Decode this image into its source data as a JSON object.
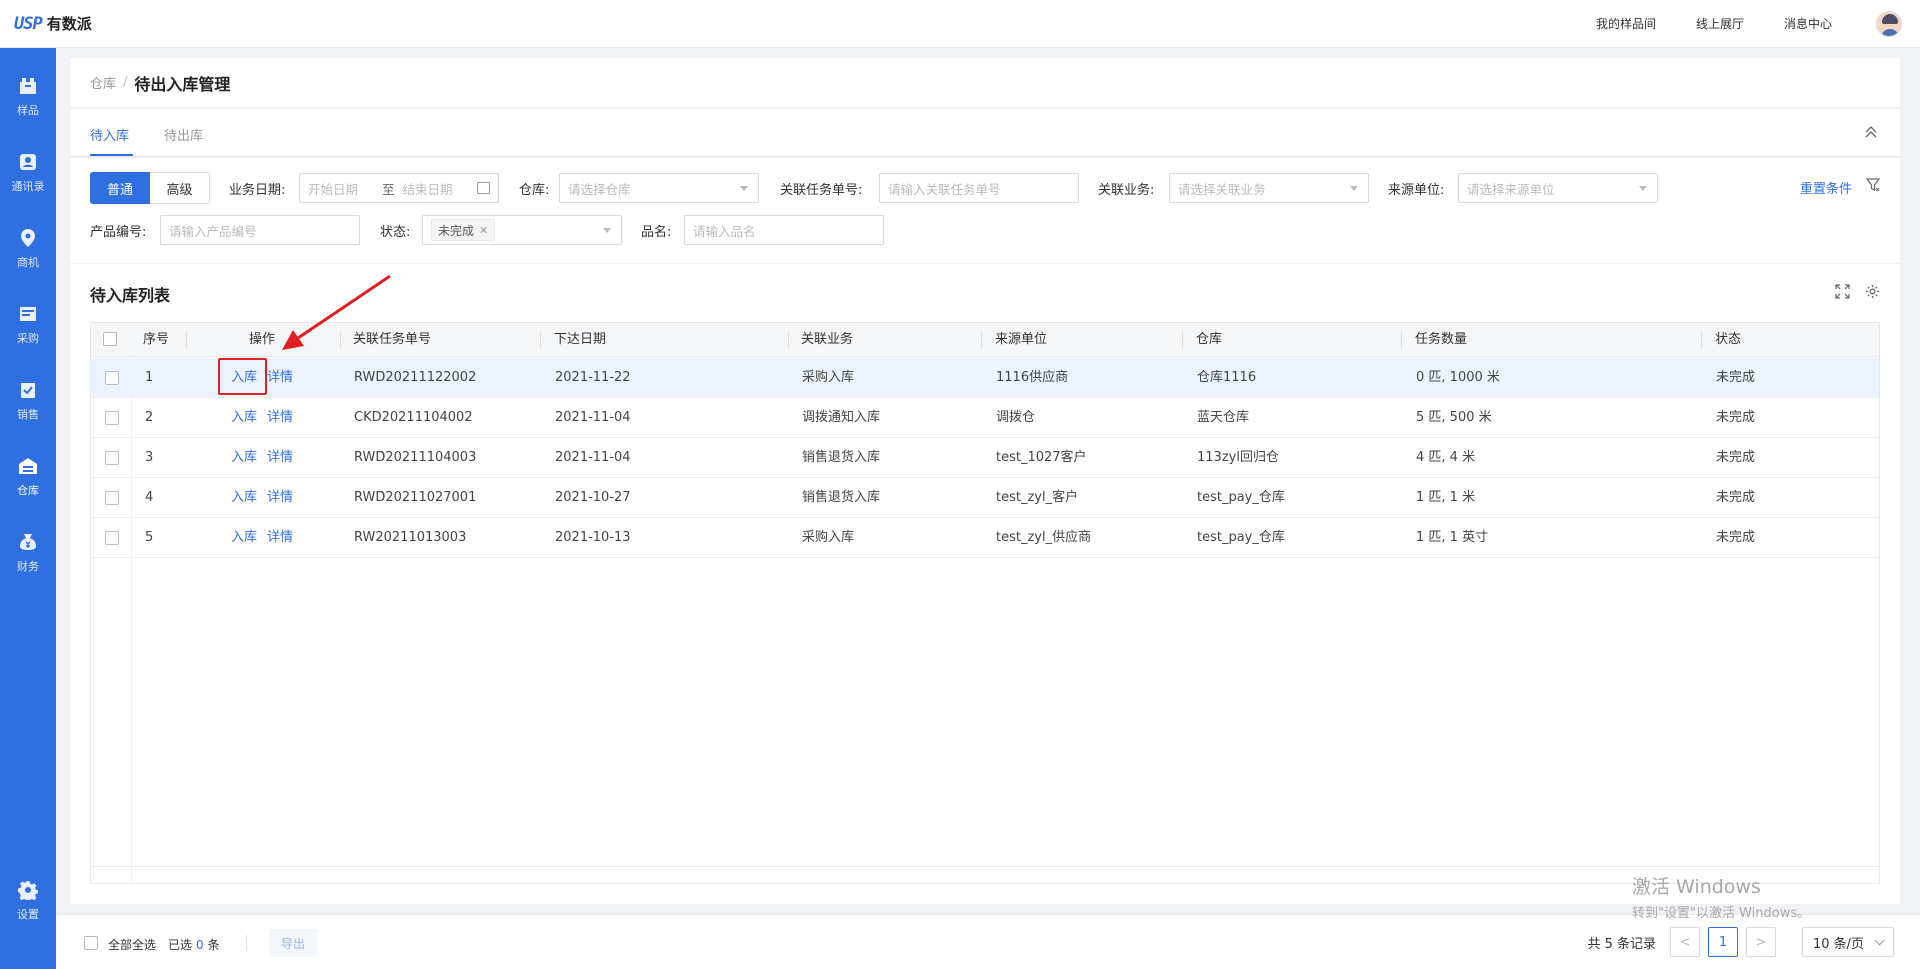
{
  "app": {
    "logo_mark": "USP",
    "logo_name": "有数派"
  },
  "topnav": [
    "我的样品间",
    "线上展厅",
    "消息中心"
  ],
  "sidebar": [
    {
      "label": "样品",
      "icon": "sample-icon"
    },
    {
      "label": "通讯录",
      "icon": "contacts-icon"
    },
    {
      "label": "商机",
      "icon": "opportunity-icon"
    },
    {
      "label": "采购",
      "icon": "purchase-icon"
    },
    {
      "label": "销售",
      "icon": "sales-icon"
    },
    {
      "label": "仓库",
      "icon": "warehouse-icon",
      "active": true
    },
    {
      "label": "财务",
      "icon": "finance-icon"
    },
    {
      "label": "设置",
      "icon": "settings-icon"
    }
  ],
  "breadcrumb": {
    "parent": "仓库",
    "separator": "/",
    "current": "待出入库管理"
  },
  "tabs": [
    "待入库",
    "待出库"
  ],
  "filters": {
    "mode_normal": "普通",
    "mode_advanced": "高级",
    "date_label": "业务日期:",
    "date_start": "开始日期",
    "date_sep": "至",
    "date_end": "结束日期",
    "warehouse_label": "仓库:",
    "warehouse_placeholder": "请选择仓库",
    "task_label": "关联任务单号:",
    "task_placeholder": "请输入关联任务单号",
    "business_label": "关联业务:",
    "business_placeholder": "请选择关联业务",
    "source_label": "来源单位:",
    "source_placeholder": "请选择来源单位",
    "product_label": "产品编号:",
    "product_placeholder": "请输入产品编号",
    "status_label": "状态:",
    "status_tag": "未完成",
    "name_label": "品名:",
    "name_placeholder": "请输入品名",
    "reset": "重置条件"
  },
  "list": {
    "title": "待入库列表",
    "columns": [
      "序号",
      "操作",
      "关联任务单号",
      "下达日期",
      "关联业务",
      "来源单位",
      "仓库",
      "任务数量",
      "状态"
    ],
    "action_in": "入库",
    "action_detail": "详情",
    "rows": [
      [
        "1",
        "RWD20211122002",
        "2021-11-22",
        "采购入库",
        "1116供应商",
        "仓库1116",
        "0 匹, 1000 米",
        "未完成"
      ],
      [
        "2",
        "CKD20211104002",
        "2021-11-04",
        "调拨通知入库",
        "调拨仓",
        "蓝天仓库",
        "5 匹, 500 米",
        "未完成"
      ],
      [
        "3",
        "RWD20211104003",
        "2021-11-04",
        "销售退货入库",
        "test_1027客户",
        "113zyl回归仓",
        "4 匹, 4 米",
        "未完成"
      ],
      [
        "4",
        "RWD20211027001",
        "2021-10-27",
        "销售退货入库",
        "test_zyl_客户",
        "test_pay_仓库",
        "1 匹, 1 米",
        "未完成"
      ],
      [
        "5",
        "RW20211013003",
        "2021-10-13",
        "采购入库",
        "test_zyl_供应商",
        "test_pay_仓库",
        "1 匹, 1 英寸",
        "未完成"
      ]
    ]
  },
  "footer": {
    "select_all": "全部全选",
    "selected_prefix": "已选",
    "selected_count": "0",
    "selected_suffix": "条",
    "export": "导出",
    "total": "共 5 条记录",
    "prev": "<",
    "current_page": "1",
    "next": ">",
    "page_size": "10 条/页"
  },
  "watermark": {
    "line1": "激活 Windows",
    "line2": "转到\"设置\"以激活 Windows。"
  },
  "colors": {
    "primary": "#2f6fe0",
    "highlight": "#e02020"
  }
}
